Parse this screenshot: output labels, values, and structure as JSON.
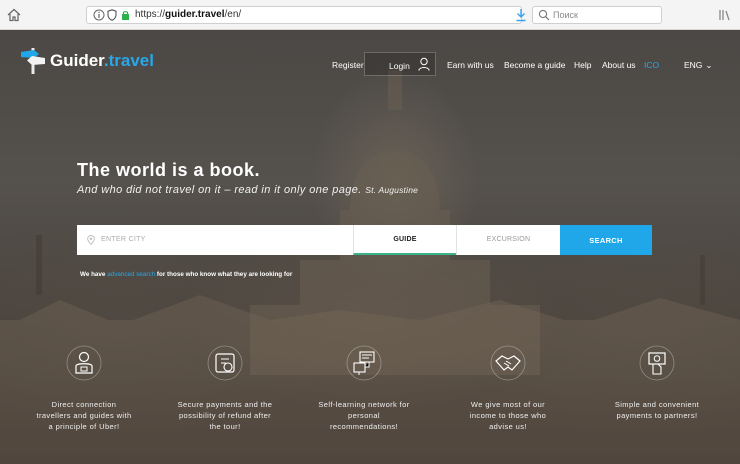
{
  "browser": {
    "url_prefix": "https://",
    "url_domain": "guider.travel",
    "url_path": "/en/",
    "page_actions": "•••",
    "search_placeholder": "Поиск"
  },
  "logo": {
    "name": "Guider",
    "tld": ".travel"
  },
  "nav": {
    "register": "Register",
    "login": "Login",
    "earn": "Earn with us",
    "become_guide": "Become a guide",
    "help": "Help",
    "about": "About us",
    "ico": "ICO",
    "lang": "ENG",
    "lang_chevron": "⌄"
  },
  "hero": {
    "title": "The world is a book.",
    "subtitle": "And who did not travel on it – read in it only one page.",
    "author": "St. Augustine"
  },
  "search": {
    "city_placeholder": "ENTER CITY",
    "tab_guide": "GUIDE",
    "tab_excursion": "EXCURSION",
    "button": "SEARCH",
    "adv_prefix": "We have",
    "adv_link": "advanced search",
    "adv_suffix": "for those who know what they are looking for"
  },
  "features": [
    {
      "icon": "guide-person-icon",
      "line1": "Direct connection",
      "line2": "travellers and guides with",
      "line3": "a principle of Uber!"
    },
    {
      "icon": "secure-payment-icon",
      "line1": "Secure payments and the",
      "line2": "possibility of refund after",
      "line3": "the tour!"
    },
    {
      "icon": "network-learning-icon",
      "line1": "Self-learning network for",
      "line2": "personal",
      "line3": "recommendations!"
    },
    {
      "icon": "handshake-icon",
      "line1": "We give most of our",
      "line2": "income to those who",
      "line3": "advise us!"
    },
    {
      "icon": "partner-payment-icon",
      "line1": "Simple and convenient",
      "line2": "payments to partners!",
      "line3": ""
    }
  ],
  "colors": {
    "accent": "#1fa7ea",
    "tab_underline": "#3ab28a",
    "logo_tld": "#2aa7e8"
  }
}
